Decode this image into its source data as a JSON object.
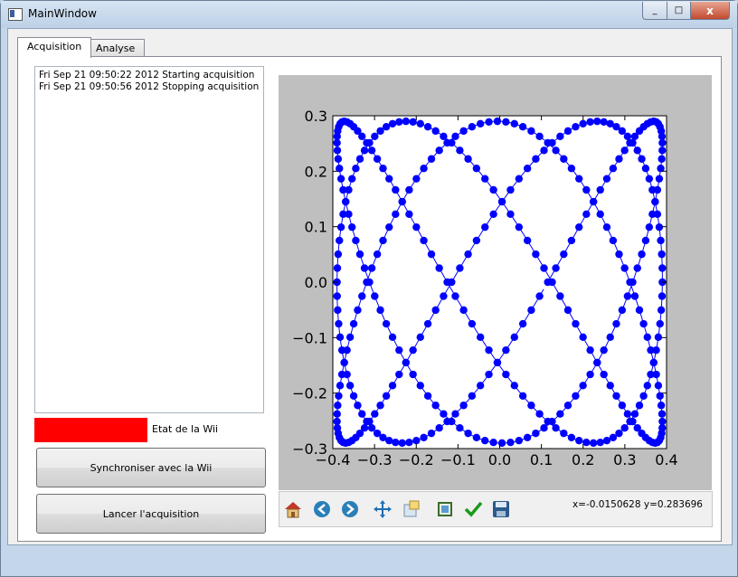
{
  "window": {
    "title": "MainWindow",
    "minimize": "_",
    "maximize": "□",
    "close": "x"
  },
  "tabs": [
    {
      "label": "Acquisition"
    },
    {
      "label": "Analyse"
    }
  ],
  "log": {
    "lines": [
      "Fri Sep 21 09:50:22 2012 Starting acquisition",
      "Fri Sep 21 09:50:56 2012 Stopping acquisition"
    ]
  },
  "status": {
    "label": "Etat de la Wii",
    "color": "#ff0000"
  },
  "buttons": {
    "sync": "Synchroniser avec la Wii",
    "start": "Lancer l'acquisition"
  },
  "toolbar": {
    "icons": [
      "home-icon",
      "back-icon",
      "forward-icon",
      "pan-icon",
      "zoom-icon",
      "subplots-icon",
      "check-icon",
      "save-icon"
    ],
    "coords": "x=-0.0150628   y=0.283696"
  },
  "chart_data": {
    "type": "line",
    "marker": "circle",
    "color": "#0000ff",
    "xlim": [
      -0.4,
      0.4
    ],
    "ylim": [
      -0.3,
      0.3
    ],
    "xticks": [
      "−0.4",
      "−0.3",
      "−0.2",
      "−0.1",
      "0.0",
      "0.1",
      "0.2",
      "0.3",
      "0.4"
    ],
    "yticks": [
      "0.3",
      "0.2",
      "0.1",
      "0.0",
      "−0.1",
      "−0.2",
      "−0.3"
    ],
    "series": [
      {
        "curve": "lissajous",
        "x_amplitude": 0.39,
        "y_amplitude": 0.29,
        "x_frequency": 3,
        "y_frequency": 5
      }
    ]
  }
}
